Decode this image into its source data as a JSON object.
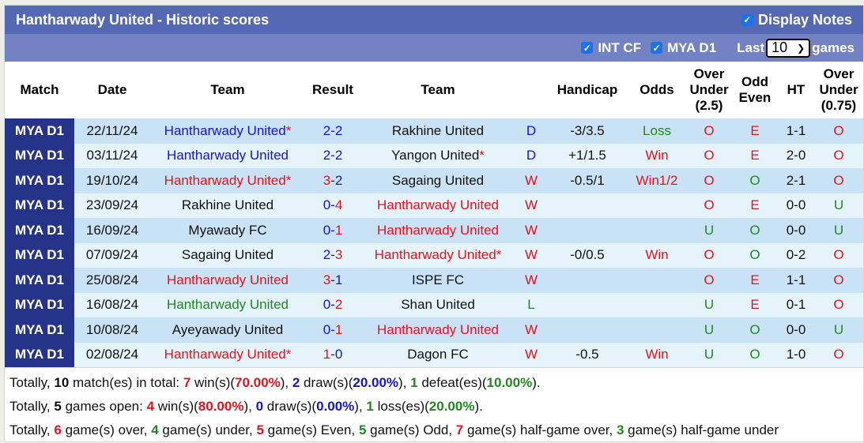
{
  "header": {
    "title": "Hantharwady United - Historic scores",
    "display_notes_label": "Display Notes",
    "display_notes_checked": true
  },
  "filters": {
    "int_cf_label": "INT CF",
    "int_cf_checked": true,
    "mya_d1_label": "MYA D1",
    "mya_d1_checked": true,
    "last_label": "Last",
    "last_value": "10",
    "games_label": "games"
  },
  "columns": {
    "match": "Match",
    "date": "Date",
    "team_home": "Team",
    "result": "Result",
    "team_away": "Team",
    "handicap": "Handicap",
    "odds": "Odds",
    "over_under_l1": "Over",
    "over_under_l2": "Under",
    "over_under_l3": "(2.5)",
    "odd_even_l1": "Odd",
    "odd_even_l2": "Even",
    "ht": "HT",
    "ou075_l1": "Over",
    "ou075_l2": "Under",
    "ou075_l3": "(0.75)"
  },
  "colors": {
    "win": "#e8121b",
    "draw": "#1515d0",
    "loss": "#1e8a1e",
    "header_bar": "#5468b4",
    "filter_bar": "#7282c2",
    "league_cell": "#253488"
  },
  "rows": [
    {
      "league": "MYA D1",
      "date": "22/11/24",
      "home": "Hantharwady United",
      "home_star": "*",
      "home_color": "blue",
      "score_home": "2",
      "score_away": "2",
      "sh_color": "blue",
      "sa_color": "blue",
      "away": "Rakhine United",
      "away_star": "",
      "away_color": "black",
      "outcome": "D",
      "outcome_color": "blue",
      "handicap": "-3/3.5",
      "odds": "Loss",
      "odds_color": "green",
      "ou": "O",
      "ou_color": "red",
      "oe": "E",
      "oe_color": "red",
      "ht": "1-1",
      "ou075": "O",
      "ou075_color": "red"
    },
    {
      "league": "MYA D1",
      "date": "03/11/24",
      "home": "Hantharwady United",
      "home_star": "",
      "home_color": "blue",
      "score_home": "2",
      "score_away": "2",
      "sh_color": "blue",
      "sa_color": "blue",
      "away": "Yangon United",
      "away_star": "*",
      "away_color": "black",
      "outcome": "D",
      "outcome_color": "blue",
      "handicap": "+1/1.5",
      "odds": "Win",
      "odds_color": "red",
      "ou": "O",
      "ou_color": "red",
      "oe": "E",
      "oe_color": "red",
      "ht": "2-0",
      "ou075": "O",
      "ou075_color": "red"
    },
    {
      "league": "MYA D1",
      "date": "19/10/24",
      "home": "Hantharwady United",
      "home_star": "*",
      "home_color": "red",
      "score_home": "3",
      "score_away": "2",
      "sh_color": "red",
      "sa_color": "blue",
      "away": "Sagaing United",
      "away_star": "",
      "away_color": "black",
      "outcome": "W",
      "outcome_color": "red",
      "handicap": "-0.5/1",
      "odds": "Win1/2",
      "odds_color": "red",
      "ou": "O",
      "ou_color": "red",
      "oe": "O",
      "oe_color": "green",
      "ht": "2-1",
      "ou075": "O",
      "ou075_color": "red"
    },
    {
      "league": "MYA D1",
      "date": "23/09/24",
      "home": "Rakhine United",
      "home_star": "",
      "home_color": "black",
      "score_home": "0",
      "score_away": "4",
      "sh_color": "blue",
      "sa_color": "red",
      "away": "Hantharwady United",
      "away_star": "",
      "away_color": "red",
      "outcome": "W",
      "outcome_color": "red",
      "handicap": "",
      "odds": "",
      "odds_color": "red",
      "ou": "O",
      "ou_color": "red",
      "oe": "E",
      "oe_color": "red",
      "ht": "0-0",
      "ou075": "U",
      "ou075_color": "green"
    },
    {
      "league": "MYA D1",
      "date": "16/09/24",
      "home": "Myawady FC",
      "home_star": "",
      "home_color": "black",
      "score_home": "0",
      "score_away": "1",
      "sh_color": "blue",
      "sa_color": "red",
      "away": "Hantharwady United",
      "away_star": "",
      "away_color": "red",
      "outcome": "W",
      "outcome_color": "red",
      "handicap": "",
      "odds": "",
      "odds_color": "red",
      "ou": "U",
      "ou_color": "green",
      "oe": "O",
      "oe_color": "green",
      "ht": "0-0",
      "ou075": "U",
      "ou075_color": "green"
    },
    {
      "league": "MYA D1",
      "date": "07/09/24",
      "home": "Sagaing United",
      "home_star": "",
      "home_color": "black",
      "score_home": "2",
      "score_away": "3",
      "sh_color": "blue",
      "sa_color": "red",
      "away": "Hantharwady United",
      "away_star": "*",
      "away_color": "red",
      "outcome": "W",
      "outcome_color": "red",
      "handicap": "-0/0.5",
      "odds": "Win",
      "odds_color": "red",
      "ou": "O",
      "ou_color": "red",
      "oe": "O",
      "oe_color": "green",
      "ht": "0-2",
      "ou075": "O",
      "ou075_color": "red"
    },
    {
      "league": "MYA D1",
      "date": "25/08/24",
      "home": "Hantharwady United",
      "home_star": "",
      "home_color": "red",
      "score_home": "3",
      "score_away": "1",
      "sh_color": "red",
      "sa_color": "blue",
      "away": "ISPE FC",
      "away_star": "",
      "away_color": "black",
      "outcome": "W",
      "outcome_color": "red",
      "handicap": "",
      "odds": "",
      "odds_color": "red",
      "ou": "O",
      "ou_color": "red",
      "oe": "E",
      "oe_color": "red",
      "ht": "1-1",
      "ou075": "O",
      "ou075_color": "red"
    },
    {
      "league": "MYA D1",
      "date": "16/08/24",
      "home": "Hantharwady United",
      "home_star": "",
      "home_color": "green",
      "score_home": "0",
      "score_away": "2",
      "sh_color": "blue",
      "sa_color": "red",
      "away": "Shan United",
      "away_star": "",
      "away_color": "black",
      "outcome": "L",
      "outcome_color": "green",
      "handicap": "",
      "odds": "",
      "odds_color": "red",
      "ou": "U",
      "ou_color": "green",
      "oe": "E",
      "oe_color": "red",
      "ht": "0-1",
      "ou075": "O",
      "ou075_color": "red"
    },
    {
      "league": "MYA D1",
      "date": "10/08/24",
      "home": "Ayeyawady United",
      "home_star": "",
      "home_color": "black",
      "score_home": "0",
      "score_away": "1",
      "sh_color": "blue",
      "sa_color": "red",
      "away": "Hantharwady United",
      "away_star": "",
      "away_color": "red",
      "outcome": "W",
      "outcome_color": "red",
      "handicap": "",
      "odds": "",
      "odds_color": "red",
      "ou": "U",
      "ou_color": "green",
      "oe": "O",
      "oe_color": "green",
      "ht": "0-0",
      "ou075": "U",
      "ou075_color": "green"
    },
    {
      "league": "MYA D1",
      "date": "02/08/24",
      "home": "Hantharwady United",
      "home_star": "*",
      "home_color": "red",
      "score_home": "1",
      "score_away": "0",
      "sh_color": "red",
      "sa_color": "blue",
      "away": "Dagon FC",
      "away_star": "",
      "away_color": "black",
      "outcome": "W",
      "outcome_color": "red",
      "handicap": "-0.5",
      "odds": "Win",
      "odds_color": "red",
      "ou": "U",
      "ou_color": "green",
      "oe": "O",
      "oe_color": "green",
      "ht": "1-0",
      "ou075": "O",
      "ou075_color": "red"
    }
  ],
  "summary": {
    "line1": [
      {
        "t": "Totally, ",
        "c": "",
        "b": false
      },
      {
        "t": "10",
        "c": "black",
        "b": true
      },
      {
        "t": " match(es) in total: ",
        "c": "",
        "b": false
      },
      {
        "t": "7",
        "c": "red",
        "b": true
      },
      {
        "t": " win(s)(",
        "c": "",
        "b": false
      },
      {
        "t": "70.00%",
        "c": "red",
        "b": true
      },
      {
        "t": "), ",
        "c": "",
        "b": false
      },
      {
        "t": "2",
        "c": "blue",
        "b": true
      },
      {
        "t": " draw(s)(",
        "c": "",
        "b": false
      },
      {
        "t": "20.00%",
        "c": "blue",
        "b": true
      },
      {
        "t": "), ",
        "c": "",
        "b": false
      },
      {
        "t": "1",
        "c": "green",
        "b": true
      },
      {
        "t": " defeat(es)(",
        "c": "",
        "b": false
      },
      {
        "t": "10.00%",
        "c": "green",
        "b": true
      },
      {
        "t": ").",
        "c": "",
        "b": false
      }
    ],
    "line2": [
      {
        "t": "Totally, ",
        "c": "",
        "b": false
      },
      {
        "t": "5",
        "c": "black",
        "b": true
      },
      {
        "t": " games open: ",
        "c": "",
        "b": false
      },
      {
        "t": "4",
        "c": "red",
        "b": true
      },
      {
        "t": " win(s)(",
        "c": "",
        "b": false
      },
      {
        "t": "80.00%",
        "c": "red",
        "b": true
      },
      {
        "t": "), ",
        "c": "",
        "b": false
      },
      {
        "t": "0",
        "c": "blue",
        "b": true
      },
      {
        "t": " draw(s)(",
        "c": "",
        "b": false
      },
      {
        "t": "0.00%",
        "c": "blue",
        "b": true
      },
      {
        "t": "), ",
        "c": "",
        "b": false
      },
      {
        "t": "1",
        "c": "green",
        "b": true
      },
      {
        "t": " loss(es)(",
        "c": "",
        "b": false
      },
      {
        "t": "20.00%",
        "c": "green",
        "b": true
      },
      {
        "t": ").",
        "c": "",
        "b": false
      }
    ],
    "line3": [
      {
        "t": "Totally, ",
        "c": "",
        "b": false
      },
      {
        "t": "6",
        "c": "red",
        "b": true
      },
      {
        "t": " game(s) over, ",
        "c": "",
        "b": false
      },
      {
        "t": "4",
        "c": "green",
        "b": true
      },
      {
        "t": " game(s) under, ",
        "c": "",
        "b": false
      },
      {
        "t": "5",
        "c": "red",
        "b": true
      },
      {
        "t": " game(s) Even, ",
        "c": "",
        "b": false
      },
      {
        "t": "5",
        "c": "green",
        "b": true
      },
      {
        "t": " game(s) Odd, ",
        "c": "",
        "b": false
      },
      {
        "t": "7",
        "c": "red",
        "b": true
      },
      {
        "t": " game(s) half-game over, ",
        "c": "",
        "b": false
      },
      {
        "t": "3",
        "c": "green",
        "b": true
      },
      {
        "t": " game(s) half-game under",
        "c": "",
        "b": false
      }
    ]
  }
}
